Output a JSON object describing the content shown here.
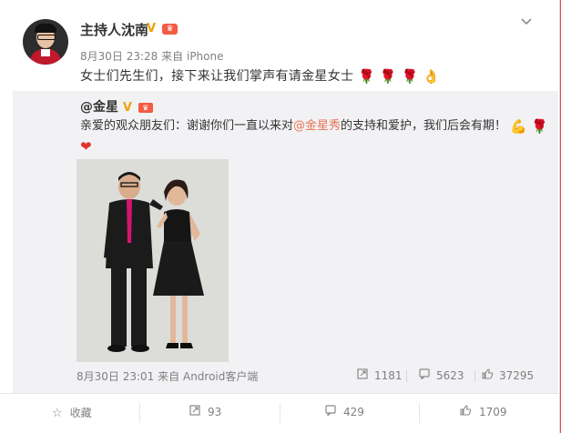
{
  "post": {
    "author": "主持人沈南",
    "verified_mark": "V",
    "date": "8月30日 23:28",
    "source_prefix": "来自",
    "source": "iPhone",
    "text": "女士们先生们，接下来让我们掌声有请金星女士"
  },
  "repost": {
    "author": "@金星",
    "verified_mark": "V",
    "text_a": "亲爱的观众朋友们：谢谢你们一直以来对",
    "mention": "@金星秀",
    "text_b": "的支持和爱护，我们后会有期！",
    "date": "8月30日 23:01",
    "source_prefix": "来自",
    "source": "Android客户端",
    "reposts": "1181",
    "comments": "5623",
    "likes": "37295"
  },
  "bottom_bar": {
    "favorite_label": "收藏",
    "repost_count": "93",
    "comment_count": "429",
    "like_count": "1709"
  },
  "colors": {
    "page_bg": "#e94a4f",
    "accent": "#eb7350",
    "repost_bg": "#f2f2f5",
    "verified": "#f0a30a"
  }
}
